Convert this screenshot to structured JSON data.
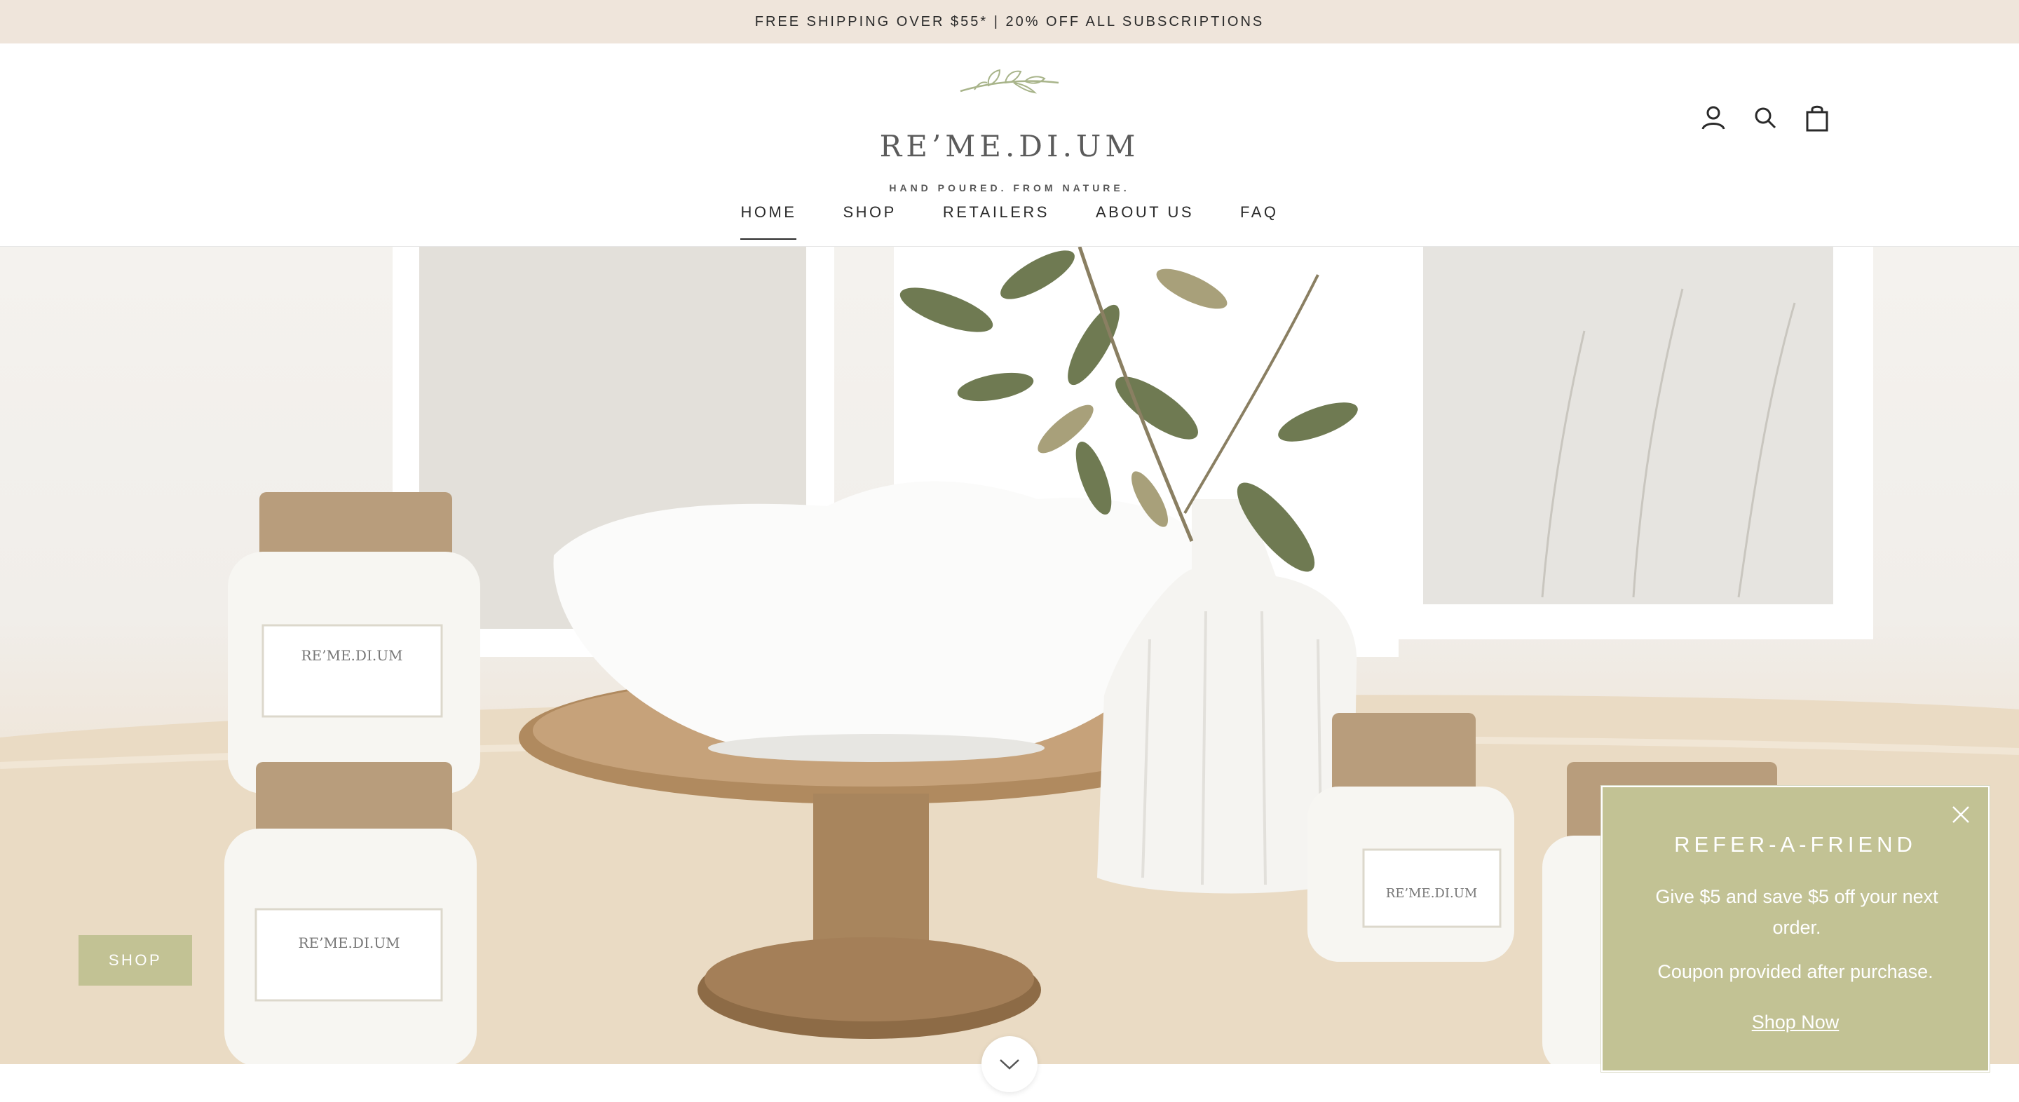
{
  "announcement": "FREE SHIPPING OVER $55* | 20% OFF ALL SUBSCRIPTIONS",
  "brand": {
    "wordmark": "RE’ME.DI.UM",
    "tagline": "HAND POURED. FROM NATURE."
  },
  "header_icons": [
    "account-icon",
    "search-icon",
    "cart-icon"
  ],
  "nav": {
    "items": [
      {
        "label": "HOME",
        "active": true
      },
      {
        "label": "SHOP",
        "active": false
      },
      {
        "label": "RETAILERS",
        "active": false
      },
      {
        "label": "ABOUT US",
        "active": false
      },
      {
        "label": "FAQ",
        "active": false
      }
    ]
  },
  "hero": {
    "shop_button": "SHOP",
    "candle_labels": {
      "wordmark": "RE’ME.DI.UM"
    }
  },
  "refer": {
    "title": "REFER-A-FRIEND",
    "line1": "Give $5 and save $5 off your next order.",
    "line2": "Coupon provided after purchase.",
    "link": "Shop Now"
  },
  "colors": {
    "announcement_bg": "#efe5db",
    "accent_sage": "#c2c294",
    "text": "#2a2a2a"
  }
}
